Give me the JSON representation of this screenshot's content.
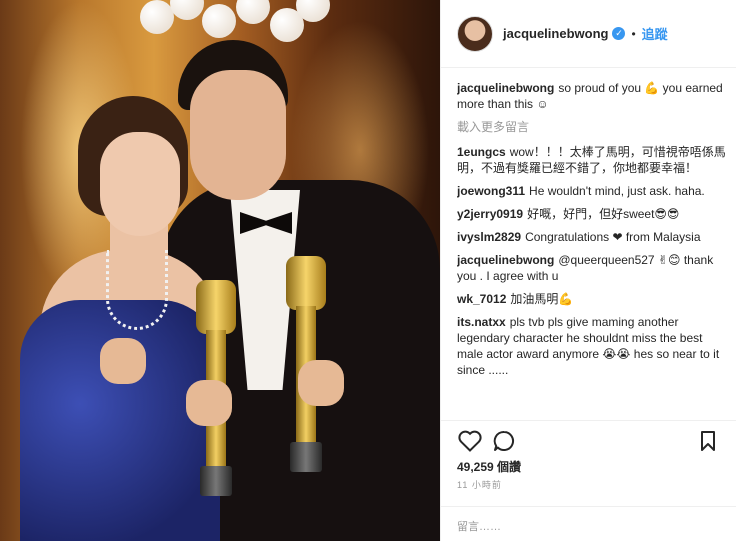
{
  "post": {
    "username": "jacquelinebwong",
    "follow_label": "追蹤",
    "separator": "•"
  },
  "caption": {
    "username": "jacquelinebwong",
    "text": "so proud of you 💪 you earned more than this ☺"
  },
  "load_more": "載入更多留言",
  "comments": [
    {
      "user": "1eungcs",
      "text": "wow！！！太棒了馬明，可惜視帝唔係馬明，不過有獎羅已經不錯了，你地都要幸福！"
    },
    {
      "user": "joewong311",
      "text": "He wouldn't mind, just ask. haha."
    },
    {
      "user": "y2jerry0919",
      "text": "好嘅，好門，但好sweet😎😎"
    },
    {
      "user": "ivyslm2829",
      "text": "Congratulations ❤ from Malaysia"
    },
    {
      "user": "jacquelinebwong",
      "mention": "@queerqueen527",
      "text": "✌😊 thank you . I agree with u"
    },
    {
      "user": "wk_7012",
      "text": "加油馬明💪"
    },
    {
      "user": "its.natxx",
      "text": "pls tvb pls give maming another legendary character he shouldnt miss the best male actor award anymore 😭😭 hes so near to it since ......"
    }
  ],
  "likes": "49,259 個讚",
  "time": "11 小時前",
  "add_comment_placeholder": "留言……",
  "icons": {
    "like": "heart-icon",
    "comment": "comment-bubble-icon",
    "save": "bookmark-icon",
    "verified": "verified-badge-icon"
  },
  "colors": {
    "link": "#3897f0",
    "muted": "#999999",
    "text": "#262626"
  }
}
